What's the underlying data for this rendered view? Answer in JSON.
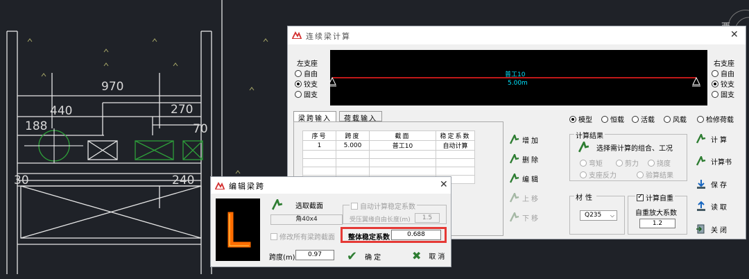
{
  "cad": {
    "dims": {
      "d970": "970",
      "d440": "440",
      "d188": "188",
      "d270": "270",
      "d70": "70",
      "d30": "30",
      "d240": "240"
    },
    "right_label": "西"
  },
  "main": {
    "title": "连续梁计算",
    "left_support": {
      "label": "左支座",
      "options": [
        "自由",
        "铰支",
        "固支"
      ],
      "selected": "铰支"
    },
    "right_support": {
      "label": "右支座",
      "options": [
        "自由",
        "铰支",
        "固支"
      ],
      "selected": "铰支"
    },
    "beam_view": {
      "section_label": "普工10",
      "length_label": "5.00m"
    },
    "tabs": [
      "梁跨输入",
      "荷载输入"
    ],
    "span_table": {
      "headers": [
        "序号",
        "跨度",
        "截面",
        "稳定系数"
      ],
      "rows": [
        [
          "1",
          "5.000",
          "普工10",
          "自动计算"
        ]
      ]
    },
    "side_buttons": {
      "add": "增加",
      "delete": "删除",
      "edit": "编辑",
      "up": "上移",
      "down": "下移"
    },
    "load_types": {
      "options": [
        "模型",
        "恒载",
        "活载",
        "风载",
        "检修荷载"
      ],
      "selected": "模型"
    },
    "results": {
      "group_title": "计算结果",
      "select_label": "选择需计算的组合、工况",
      "options": [
        "弯矩",
        "剪力",
        "挠度",
        "支座反力",
        "验算结果"
      ]
    },
    "material": {
      "label": "材性",
      "value": "Q235"
    },
    "self_weight": {
      "checkbox_label": "计算自重",
      "checked": true,
      "factor_label": "自重放大系数",
      "factor_value": "1.2"
    },
    "right_buttons": {
      "calc": "计算",
      "report": "计算书",
      "save": "保存",
      "read": "读取",
      "close": "关闭"
    }
  },
  "edit": {
    "title": "编辑梁跨",
    "choose_section": "选取截面",
    "section_value": "角40x4",
    "modify_all": "修改所有梁跨截面",
    "span_label": "跨度(m)",
    "span_value": "0.97",
    "auto_stability": "自动计算稳定系数",
    "free_length_label": "受压翼缘自由长度(m)",
    "free_length_value": "1.5",
    "overall_stability_label": "整体稳定系数",
    "overall_stability_value": "0.688",
    "ok": "确定",
    "cancel": "取消"
  },
  "colors": {
    "beam": "#ff2020",
    "beam_text": "#00e5ff",
    "highlight": "#e53935",
    "accent_green": "#2e7d32"
  }
}
